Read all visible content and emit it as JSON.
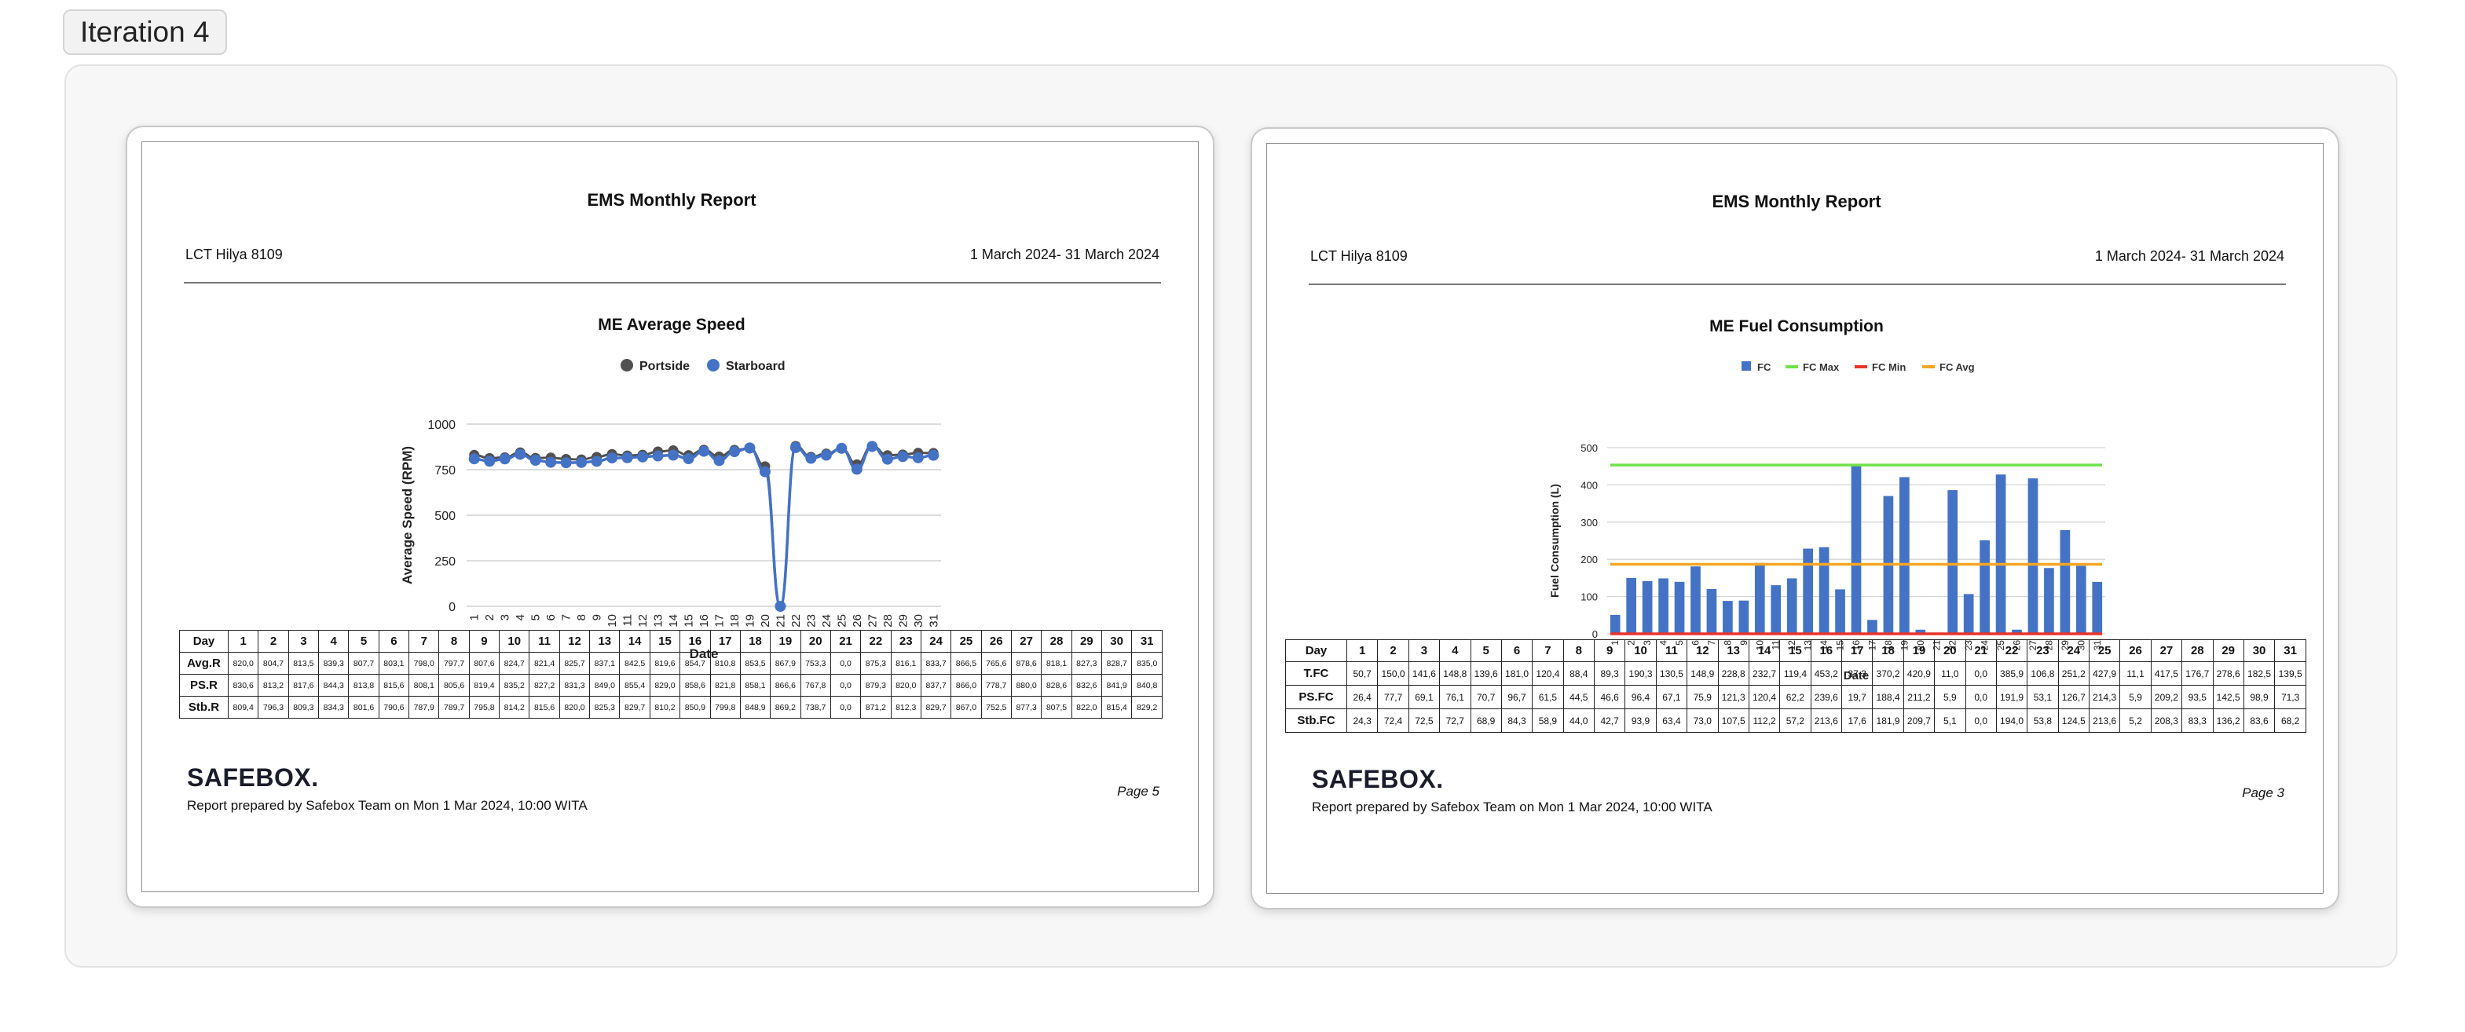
{
  "iteration_label": "Iteration 4",
  "days": [
    "1",
    "2",
    "3",
    "4",
    "5",
    "6",
    "7",
    "8",
    "9",
    "10",
    "11",
    "12",
    "13",
    "14",
    "15",
    "16",
    "17",
    "18",
    "19",
    "20",
    "21",
    "22",
    "23",
    "24",
    "25",
    "26",
    "27",
    "28",
    "29",
    "30",
    "31"
  ],
  "left_page": {
    "report_title": "EMS Monthly Report",
    "vessel": "LCT Hilya 8109",
    "period": "1 March 2024- 31 March 2024",
    "chart_title": "ME Average Speed",
    "footer_logo": "SAFEBOX.",
    "footer_note": "Report prepared by Safebox Team on Mon 1 Mar 2024, 10:00 WITA",
    "page_number": "Page 5",
    "table": {
      "header_label": "Day",
      "rows": [
        {
          "label": "Avg.R",
          "values": [
            "820,0",
            "804,7",
            "813,5",
            "839,3",
            "807,7",
            "803,1",
            "798,0",
            "797,7",
            "807,6",
            "824,7",
            "821,4",
            "825,7",
            "837,1",
            "842,5",
            "819,6",
            "854,7",
            "810,8",
            "853,5",
            "867,9",
            "753,3",
            "0,0",
            "875,3",
            "816,1",
            "833,7",
            "866,5",
            "765,6",
            "878,6",
            "818,1",
            "827,3",
            "828,7",
            "835,0"
          ]
        },
        {
          "label": "PS.R",
          "values": [
            "830,6",
            "813,2",
            "817,6",
            "844,3",
            "813,8",
            "815,6",
            "808,1",
            "805,6",
            "819,4",
            "835,2",
            "827,2",
            "831,3",
            "849,0",
            "855,4",
            "829,0",
            "858,6",
            "821,8",
            "858,1",
            "866,6",
            "767,8",
            "0,0",
            "879,3",
            "820,0",
            "837,7",
            "866,0",
            "778,7",
            "880,0",
            "828,6",
            "832,6",
            "841,9",
            "840,8"
          ]
        },
        {
          "label": "Stb.R",
          "values": [
            "809,4",
            "796,3",
            "809,3",
            "834,3",
            "801,6",
            "790,6",
            "787,9",
            "789,7",
            "795,8",
            "814,2",
            "815,6",
            "820,0",
            "825,3",
            "829,7",
            "810,2",
            "850,9",
            "799,8",
            "848,9",
            "869,2",
            "738,7",
            "0,0",
            "871,2",
            "812,3",
            "829,7",
            "867,0",
            "752,5",
            "877,3",
            "807,5",
            "822,0",
            "815,4",
            "829,2"
          ]
        }
      ]
    },
    "chart_data": {
      "type": "line",
      "xlabel": "Date",
      "ylabel": "Average Speed (RPM)",
      "ylim": [
        0,
        1000
      ],
      "yticks": [
        "0",
        "250",
        "500",
        "750",
        "1000"
      ],
      "x": [
        1,
        2,
        3,
        4,
        5,
        6,
        7,
        8,
        9,
        10,
        11,
        12,
        13,
        14,
        15,
        16,
        17,
        18,
        19,
        20,
        21,
        22,
        23,
        24,
        25,
        26,
        27,
        28,
        29,
        30,
        31
      ],
      "legend_position": "top-center",
      "series": [
        {
          "name": "Portside",
          "color": "#505050",
          "values": [
            830.6,
            813.2,
            817.6,
            844.3,
            813.8,
            815.6,
            808.1,
            805.6,
            819.4,
            835.2,
            827.2,
            831.3,
            849.0,
            855.4,
            829.0,
            858.6,
            821.8,
            858.1,
            866.6,
            767.8,
            0,
            879.3,
            820.0,
            837.7,
            866.0,
            778.7,
            880.0,
            828.6,
            832.6,
            841.9,
            840.8
          ]
        },
        {
          "name": "Starboard",
          "color": "#4472c4",
          "values": [
            809.4,
            796.3,
            809.3,
            834.3,
            801.6,
            790.6,
            787.9,
            789.7,
            795.8,
            814.2,
            815.6,
            820.0,
            825.3,
            829.7,
            810.2,
            850.9,
            799.8,
            848.9,
            869.2,
            738.7,
            0,
            871.2,
            812.3,
            829.7,
            867.0,
            752.5,
            877.3,
            807.5,
            822.0,
            815.4,
            829.2
          ]
        }
      ]
    }
  },
  "right_page": {
    "report_title": "EMS Monthly Report",
    "vessel": "LCT Hilya 8109",
    "period": "1 March 2024- 31 March 2024",
    "chart_title": "ME Fuel Consumption",
    "footer_logo": "SAFEBOX.",
    "footer_note": "Report prepared by Safebox Team on Mon 1 Mar 2024, 10:00 WITA",
    "page_number": "Page 3",
    "table": {
      "header_label": "Day",
      "rows": [
        {
          "label": "T.FC",
          "values": [
            "50,7",
            "150,0",
            "141,6",
            "148,8",
            "139,6",
            "181,0",
            "120,4",
            "88,4",
            "89,3",
            "190,3",
            "130,5",
            "148,9",
            "228,8",
            "232,7",
            "119,4",
            "453,2",
            "37,3",
            "370,2",
            "420,9",
            "11,0",
            "0,0",
            "385,9",
            "106,8",
            "251,2",
            "427,9",
            "11,1",
            "417,5",
            "176,7",
            "278,6",
            "182,5",
            "139,5"
          ]
        },
        {
          "label": "PS.FC",
          "values": [
            "26,4",
            "77,7",
            "69,1",
            "76,1",
            "70,7",
            "96,7",
            "61,5",
            "44,5",
            "46,6",
            "96,4",
            "67,1",
            "75,9",
            "121,3",
            "120,4",
            "62,2",
            "239,6",
            "19,7",
            "188,4",
            "211,2",
            "5,9",
            "0,0",
            "191,9",
            "53,1",
            "126,7",
            "214,3",
            "5,9",
            "209,2",
            "93,5",
            "142,5",
            "98,9",
            "71,3"
          ]
        },
        {
          "label": "Stb.FC",
          "values": [
            "24,3",
            "72,4",
            "72,5",
            "72,7",
            "68,9",
            "84,3",
            "58,9",
            "44,0",
            "42,7",
            "93,9",
            "63,4",
            "73,0",
            "107,5",
            "112,2",
            "57,2",
            "213,6",
            "17,6",
            "181,9",
            "209,7",
            "5,1",
            "0,0",
            "194,0",
            "53,8",
            "124,5",
            "213,6",
            "5,2",
            "208,3",
            "83,3",
            "136,2",
            "83,6",
            "68,2"
          ]
        }
      ]
    },
    "chart_data": {
      "type": "bar",
      "xlabel": "Date",
      "ylabel": "Fuel Consumption (L)",
      "ylim": [
        0,
        500
      ],
      "yticks": [
        "0",
        "100",
        "200",
        "300",
        "400",
        "500"
      ],
      "x": [
        1,
        2,
        3,
        4,
        5,
        6,
        7,
        8,
        9,
        10,
        11,
        12,
        13,
        14,
        15,
        16,
        17,
        18,
        19,
        20,
        21,
        22,
        23,
        24,
        25,
        26,
        27,
        28,
        29,
        30,
        31
      ],
      "legend_position": "top-center",
      "series": [
        {
          "name": "FC",
          "kind": "bar",
          "color": "#4472c4",
          "values": [
            50.7,
            150.0,
            141.6,
            148.8,
            139.6,
            181.0,
            120.4,
            88.4,
            89.3,
            190.3,
            130.5,
            148.9,
            228.8,
            232.7,
            119.4,
            453.2,
            37.3,
            370.2,
            420.9,
            11.0,
            0,
            385.9,
            106.8,
            251.2,
            427.9,
            11.1,
            417.5,
            176.7,
            278.6,
            182.5,
            139.5
          ]
        },
        {
          "name": "FC Max",
          "kind": "line",
          "color": "#6fe24a",
          "value": 453.2
        },
        {
          "name": "FC Min",
          "kind": "line",
          "color": "#e8332a",
          "value": 0
        },
        {
          "name": "FC Avg",
          "kind": "line",
          "color": "#f5a623",
          "value": 186.6
        }
      ]
    }
  }
}
